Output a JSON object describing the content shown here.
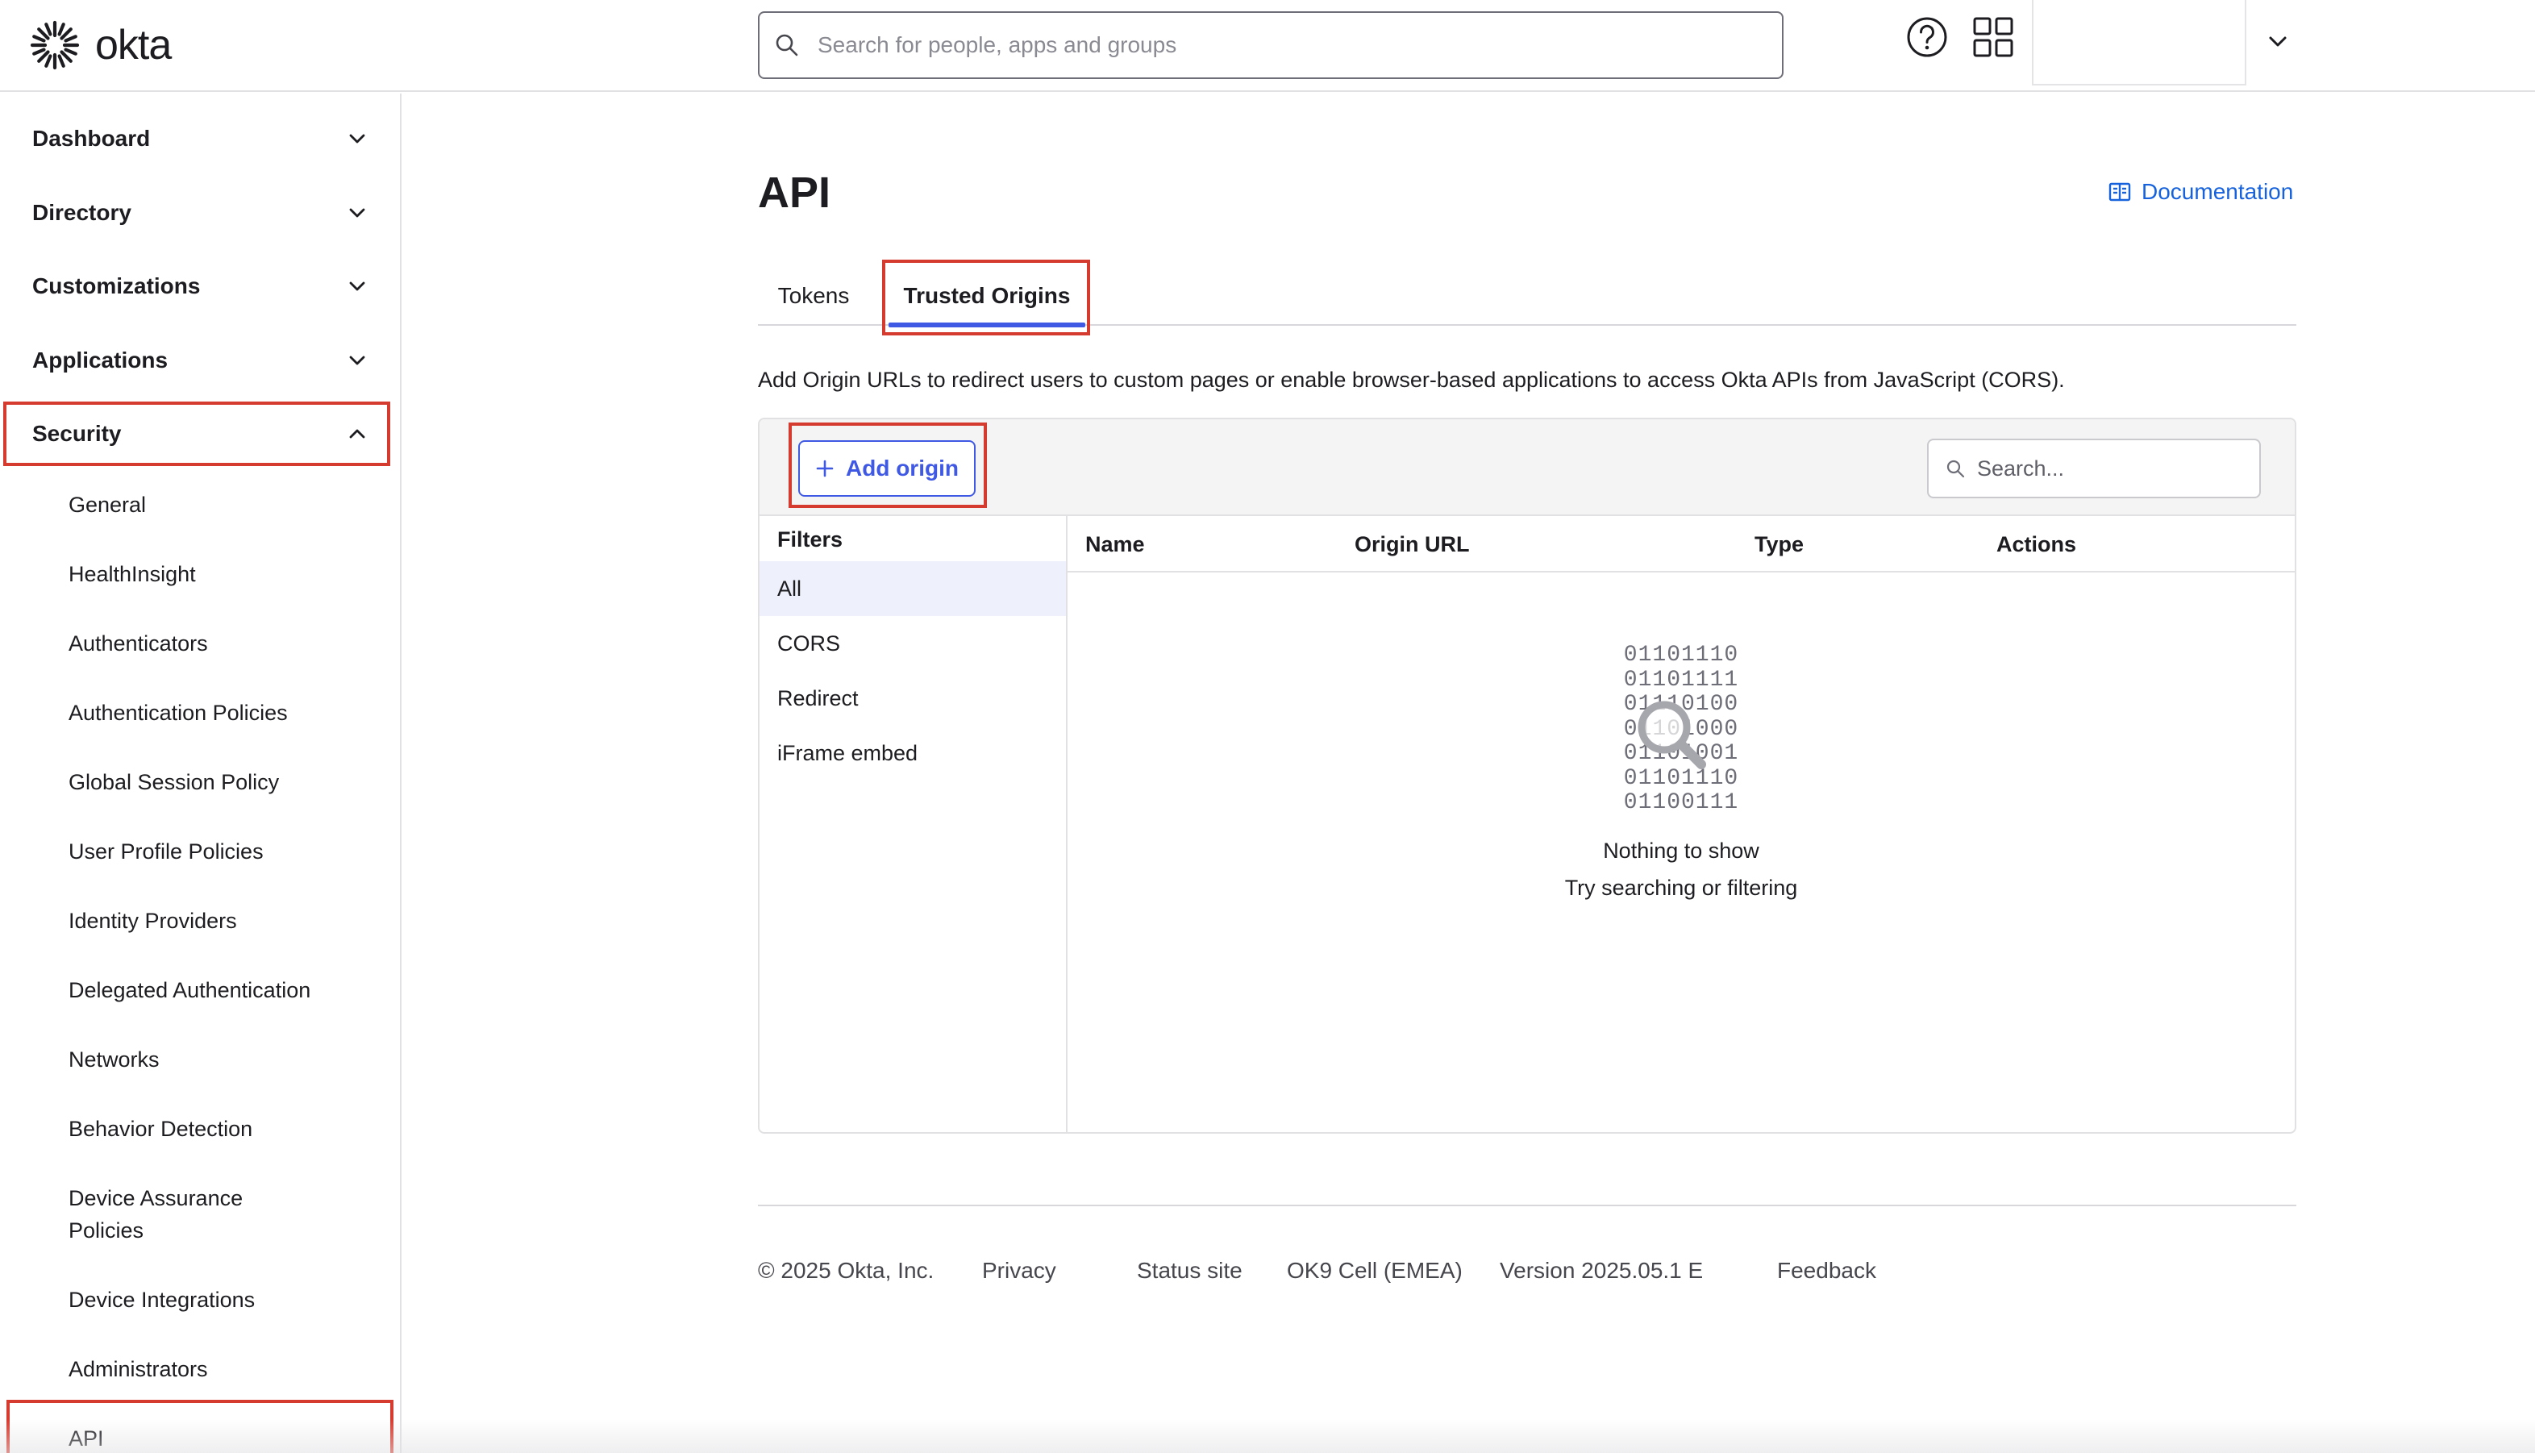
{
  "header": {
    "logo_text": "okta",
    "search_placeholder": "Search for people, apps and groups",
    "icons": [
      "okta-sunburst-icon",
      "search-icon",
      "help-icon",
      "apps-grid-icon",
      "chevron-down-icon"
    ]
  },
  "sidebar": {
    "top_items": [
      {
        "label": "Dashboard",
        "expanded": false
      },
      {
        "label": "Directory",
        "expanded": false
      },
      {
        "label": "Customizations",
        "expanded": false
      },
      {
        "label": "Applications",
        "expanded": false
      },
      {
        "label": "Security",
        "expanded": true
      }
    ],
    "security_items": [
      "General",
      "HealthInsight",
      "Authenticators",
      "Authentication Policies",
      "Global Session Policy",
      "User Profile Policies",
      "Identity Providers",
      "Delegated Authentication",
      "Networks",
      "Behavior Detection",
      "Device Assurance",
      "Policies",
      "Device Integrations",
      "Administrators",
      "API"
    ]
  },
  "main": {
    "title": "API",
    "doc_link": "Documentation",
    "tabs": [
      {
        "label": "Tokens",
        "active": false
      },
      {
        "label": "Trusted Origins",
        "active": true
      }
    ],
    "description": "Add Origin URLs to redirect users to custom pages or enable browser-based applications to access Okta APIs from JavaScript (CORS).",
    "add_button": "Add origin",
    "search_placeholder": "Search...",
    "filters": {
      "heading": "Filters",
      "items": [
        "All",
        "CORS",
        "Redirect",
        "iFrame embed"
      ],
      "selected": "All"
    },
    "columns": [
      "Name",
      "Origin URL",
      "Type",
      "Actions"
    ],
    "empty_state": {
      "binary_lines": [
        "01101110",
        "01101111",
        "01110100",
        "01101000",
        "01101001",
        "01101110",
        "01100111"
      ],
      "title": "Nothing to show",
      "subtitle": "Try searching or filtering"
    }
  },
  "footer": {
    "copyright": "© 2025 Okta, Inc.",
    "privacy": "Privacy",
    "status": "Status site",
    "cell": "OK9 Cell (EMEA)",
    "version": "Version 2025.05.1 E",
    "feedback": "Feedback"
  },
  "colors": {
    "accent": "#3f59e4",
    "link": "#1662dd",
    "highlight": "#d63b2f",
    "text": "#1d1d21"
  }
}
